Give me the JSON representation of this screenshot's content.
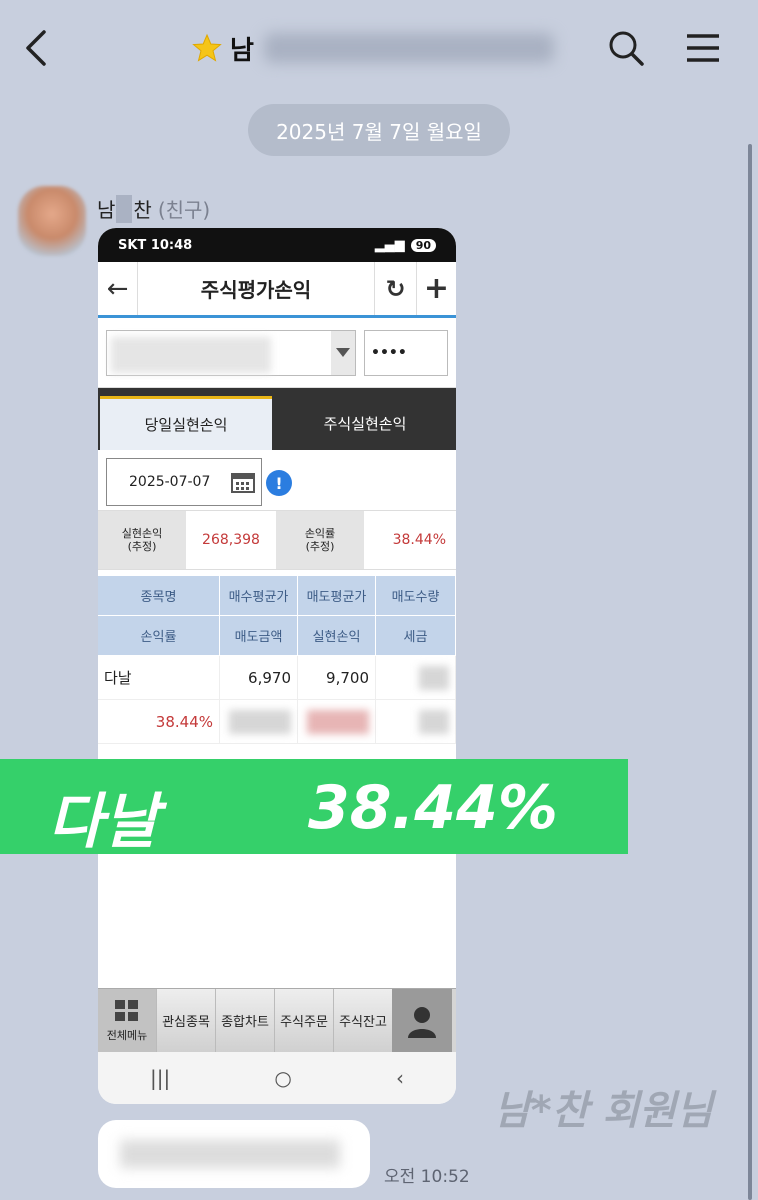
{
  "header": {
    "title_visible": "남",
    "back_icon": "chevron-left-icon",
    "star_icon": "star-icon",
    "search_icon": "search-icon",
    "menu_icon": "hamburger-menu-icon"
  },
  "date_divider": "2025년 7월 7일 월요일",
  "sender": {
    "name_first": "남",
    "name_last": "찬",
    "relation": "(친구)"
  },
  "phone": {
    "status_left": "SKT 10:48",
    "status_battery": "90",
    "app_title": "주식평가손익",
    "password_mask": "••••",
    "tabs": [
      "당일실현손익",
      "주식실현손익"
    ],
    "date_value": "2025-07-07",
    "summary": {
      "realized_label": "실현손익\n(추정)",
      "realized_value": "268,398",
      "rate_label": "손익률\n(추정)",
      "rate_value": "38.44%"
    },
    "grid_headers_row1": [
      "종목명",
      "매수평균가",
      "매도평균가",
      "매도수량"
    ],
    "grid_headers_row2": [
      "손익률",
      "매도금액",
      "실현손익",
      "세금"
    ],
    "row": {
      "name": "다날",
      "buy_avg": "6,970",
      "sell_avg": "9,700",
      "rate": "38.44%"
    },
    "bottom_menu": [
      "전체메뉴",
      "관심종목",
      "종합차트",
      "주식주문",
      "주식잔고"
    ]
  },
  "banner": {
    "stock": "다날",
    "percent": "38.44%",
    "color": "#35d06a"
  },
  "watermark": "남*찬 회원님",
  "message_time": "오전 10:52"
}
